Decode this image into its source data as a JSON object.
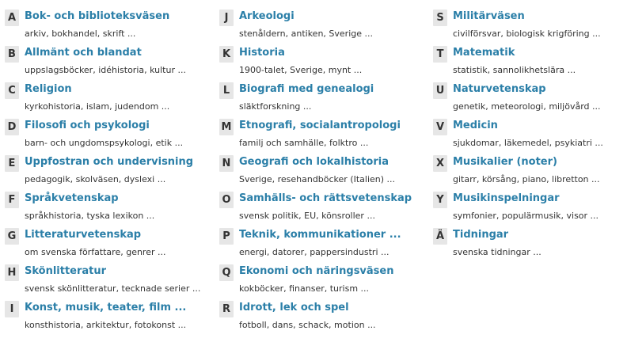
{
  "columns": [
    [
      {
        "letter": "A",
        "title": "Bok- och biblioteksväsen",
        "desc": "arkiv, bokhandel, skrift ..."
      },
      {
        "letter": "B",
        "title": "Allmänt och blandat",
        "desc": "uppslagsböcker, idéhistoria, kultur ..."
      },
      {
        "letter": "C",
        "title": "Religion",
        "desc": "kyrkohistoria, islam, judendom ..."
      },
      {
        "letter": "D",
        "title": "Filosofi och psykologi",
        "desc": "barn- och ungdomspsykologi, etik ..."
      },
      {
        "letter": "E",
        "title": "Uppfostran och undervisning",
        "desc": "pedagogik, skolväsen, dyslexi ..."
      },
      {
        "letter": "F",
        "title": "Språkvetenskap",
        "desc": "språkhistoria, tyska lexikon ..."
      },
      {
        "letter": "G",
        "title": "Litteraturvetenskap",
        "desc": "om svenska författare, genrer ..."
      },
      {
        "letter": "H",
        "title": "Skönlitteratur",
        "desc": "svensk skönlitteratur, tecknade serier ..."
      },
      {
        "letter": "I",
        "title": "Konst, musik, teater, film ...",
        "desc": "konsthistoria, arkitektur, fotokonst ..."
      }
    ],
    [
      {
        "letter": "J",
        "title": "Arkeologi",
        "desc": "stenåldern, antiken, Sverige ..."
      },
      {
        "letter": "K",
        "title": "Historia",
        "desc": "1900-talet, Sverige, mynt ..."
      },
      {
        "letter": "L",
        "title": "Biografi med genealogi",
        "desc": "släktforskning ..."
      },
      {
        "letter": "M",
        "title": "Etnografi, socialantropologi",
        "desc": "familj och samhälle, folktro ..."
      },
      {
        "letter": "N",
        "title": "Geografi och lokalhistoria",
        "desc": "Sverige, resehandböcker (Italien) ..."
      },
      {
        "letter": "O",
        "title": "Samhälls- och rättsvetenskap",
        "desc": "svensk politik, EU, könsroller ..."
      },
      {
        "letter": "P",
        "title": "Teknik, kommunikationer ...",
        "desc": "energi, datorer, pappersindustri ..."
      },
      {
        "letter": "Q",
        "title": "Ekonomi och näringsväsen",
        "desc": "kokböcker, finanser, turism ..."
      },
      {
        "letter": "R",
        "title": "Idrott, lek och spel",
        "desc": "fotboll, dans, schack, motion ..."
      }
    ],
    [
      {
        "letter": "S",
        "title": "Militärväsen",
        "desc": "civilförsvar, biologisk krigföring ..."
      },
      {
        "letter": "T",
        "title": "Matematik",
        "desc": "statistik, sannolikhetslära ..."
      },
      {
        "letter": "U",
        "title": "Naturvetenskap",
        "desc": "genetik, meteorologi, miljövård ..."
      },
      {
        "letter": "V",
        "title": "Medicin",
        "desc": "sjukdomar, läkemedel, psykiatri ..."
      },
      {
        "letter": "X",
        "title": "Musikalier (noter)",
        "desc": "gitarr, körsång, piano, libretton ..."
      },
      {
        "letter": "Y",
        "title": "Musikinspelningar",
        "desc": "symfonier, populärmusik, visor ..."
      },
      {
        "letter": "Ä",
        "title": "Tidningar",
        "desc": "svenska tidningar ..."
      }
    ]
  ]
}
